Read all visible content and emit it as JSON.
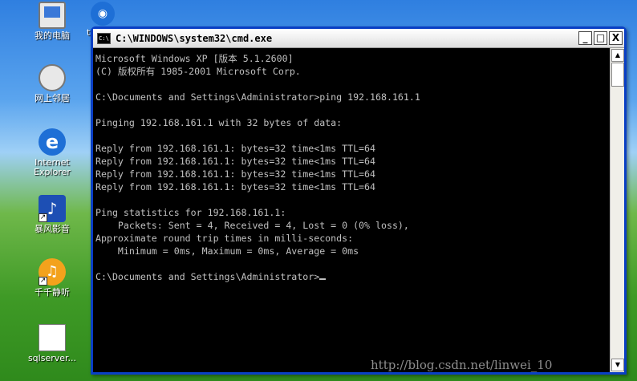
{
  "desktop": {
    "icons": [
      {
        "label": "我的电脑"
      },
      {
        "label": "网上邻居"
      },
      {
        "label": "Internet Explorer"
      },
      {
        "label": "暴风影音"
      },
      {
        "label": "千千静听"
      },
      {
        "label": "sqlserver..."
      }
    ],
    "partial_icon_label": "t"
  },
  "window": {
    "title": "C:\\WINDOWS\\system32\\cmd.exe",
    "sys_icon": "C:\\",
    "buttons": {
      "minimize": "_",
      "maximize": "□",
      "close": "X"
    },
    "console_lines": [
      "Microsoft Windows XP [版本 5.1.2600]",
      "(C) 版权所有 1985-2001 Microsoft Corp.",
      "",
      "C:\\Documents and Settings\\Administrator>ping 192.168.161.1",
      "",
      "Pinging 192.168.161.1 with 32 bytes of data:",
      "",
      "Reply from 192.168.161.1: bytes=32 time<1ms TTL=64",
      "Reply from 192.168.161.1: bytes=32 time<1ms TTL=64",
      "Reply from 192.168.161.1: bytes=32 time<1ms TTL=64",
      "Reply from 192.168.161.1: bytes=32 time<1ms TTL=64",
      "",
      "Ping statistics for 192.168.161.1:",
      "    Packets: Sent = 4, Received = 4, Lost = 0 (0% loss),",
      "Approximate round trip times in milli-seconds:",
      "    Minimum = 0ms, Maximum = 0ms, Average = 0ms",
      "",
      "C:\\Documents and Settings\\Administrator>"
    ]
  },
  "scrollbar": {
    "up": "▲",
    "down": "▼"
  },
  "watermark": "http://blog.csdn.net/linwei_10"
}
